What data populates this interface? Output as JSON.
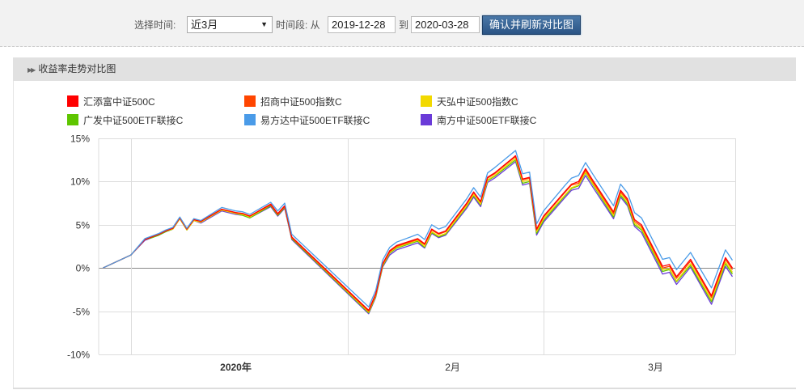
{
  "toolbar": {
    "select_time_label": "选择时间:",
    "period_value": "近3月",
    "range_label": "时间段: 从",
    "start_date": "2019-12-28",
    "to_label": "到",
    "end_date": "2020-03-28",
    "confirm_button": "确认并刷新对比图"
  },
  "panel": {
    "title": "收益率走势对比图"
  },
  "chart_data": {
    "type": "line",
    "title": "收益率走势对比图",
    "xlabel": "",
    "ylabel": "",
    "x_unit": "calendar days since 2019-12-28",
    "ylim": [
      -10,
      15
    ],
    "xlim": [
      -0.6,
      90.4
    ],
    "yticks": [
      {
        "v": 15,
        "label": "15%"
      },
      {
        "v": 10,
        "label": "10%"
      },
      {
        "v": 5,
        "label": "5%"
      },
      {
        "v": 0,
        "label": "0%"
      },
      {
        "v": -5,
        "label": "-5%"
      },
      {
        "v": -10,
        "label": "-10%"
      }
    ],
    "x_gridlines": [
      4,
      35,
      63
    ],
    "xticks": [
      {
        "d": 19,
        "label": "2020年",
        "bold": true
      },
      {
        "d": 50,
        "label": "2月",
        "bold": false
      },
      {
        "d": 79,
        "label": "3月",
        "bold": false
      }
    ],
    "legend_position": "top",
    "x": [
      0,
      4,
      6,
      7,
      8,
      9,
      10,
      11,
      12,
      13,
      14,
      17,
      19,
      20,
      21,
      24,
      25,
      26,
      27,
      38,
      39,
      40,
      41,
      42,
      45,
      46,
      47,
      48,
      49,
      52,
      53,
      54,
      55,
      56,
      59,
      60,
      61,
      62,
      63,
      66,
      67,
      68,
      69,
      70,
      73,
      74,
      75,
      76,
      77,
      80,
      81,
      82,
      84,
      87,
      89,
      90
    ],
    "series": [
      {
        "name": "汇添富中证500C",
        "color": "#ff0000",
        "values": [
          0,
          1.5,
          3.3,
          3.6,
          3.9,
          4.3,
          4.6,
          5.8,
          4.5,
          5.6,
          5.4,
          6.8,
          6.4,
          6.3,
          6.0,
          7.4,
          6.3,
          7.2,
          3.6,
          -4.9,
          -3.0,
          0.5,
          2.0,
          2.6,
          3.4,
          2.8,
          4.5,
          4.0,
          4.3,
          7.5,
          8.8,
          7.7,
          10.5,
          11.0,
          13.0,
          10.3,
          10.5,
          4.5,
          6.0,
          8.8,
          9.7,
          10.0,
          11.5,
          10.2,
          6.5,
          9.0,
          8.0,
          5.6,
          5.0,
          0.2,
          0.4,
          -1.0,
          1.0,
          -3.2,
          1.2,
          0.0
        ]
      },
      {
        "name": "招商中证500指数C",
        "color": "#ff4500",
        "values": [
          0,
          1.5,
          3.3,
          3.6,
          3.9,
          4.3,
          4.6,
          5.8,
          4.5,
          5.6,
          5.4,
          6.8,
          6.4,
          6.3,
          6.0,
          7.3,
          6.2,
          7.1,
          3.5,
          -5.0,
          -3.1,
          0.4,
          1.9,
          2.5,
          3.3,
          2.7,
          4.4,
          3.9,
          4.2,
          7.4,
          8.7,
          7.6,
          10.4,
          10.9,
          12.9,
          10.2,
          10.4,
          4.4,
          5.9,
          8.7,
          9.6,
          9.8,
          11.3,
          10.0,
          6.3,
          8.8,
          7.8,
          5.4,
          4.8,
          0.0,
          0.2,
          -1.2,
          0.8,
          -3.4,
          1.0,
          -0.2
        ]
      },
      {
        "name": "天弘中证500指数C",
        "color": "#f2d900",
        "values": [
          0,
          1.5,
          3.3,
          3.6,
          3.9,
          4.3,
          4.5,
          5.7,
          4.4,
          5.5,
          5.3,
          6.7,
          6.3,
          6.2,
          5.9,
          7.3,
          6.2,
          7.1,
          3.5,
          -5.1,
          -3.2,
          0.3,
          1.8,
          2.4,
          3.2,
          2.5,
          4.2,
          3.7,
          4.0,
          7.2,
          8.5,
          7.4,
          10.2,
          10.7,
          12.7,
          10.0,
          10.2,
          4.2,
          5.7,
          8.4,
          9.3,
          9.6,
          11.1,
          9.8,
          6.1,
          8.6,
          7.6,
          5.2,
          4.6,
          -0.2,
          -0.1,
          -1.5,
          0.5,
          -3.7,
          0.7,
          -0.5
        ]
      },
      {
        "name": "广发中证500ETF联接C",
        "color": "#5ec500",
        "values": [
          0,
          1.5,
          3.3,
          3.5,
          3.8,
          4.2,
          4.5,
          5.7,
          4.4,
          5.5,
          5.3,
          6.7,
          6.3,
          6.1,
          5.8,
          7.2,
          6.1,
          7.0,
          3.4,
          -5.2,
          -3.3,
          0.2,
          1.7,
          2.3,
          3.1,
          2.4,
          4.1,
          3.6,
          3.9,
          7.1,
          8.4,
          7.3,
          10.1,
          10.6,
          12.5,
          9.8,
          10.0,
          4.0,
          5.5,
          8.3,
          9.2,
          9.5,
          11.0,
          9.7,
          5.9,
          8.4,
          7.4,
          5.0,
          4.4,
          -0.4,
          -0.2,
          -1.6,
          0.3,
          -3.9,
          0.5,
          -0.7
        ]
      },
      {
        "name": "易方达中证500ETF联接C",
        "color": "#4a9be8",
        "values": [
          0,
          1.5,
          3.4,
          3.7,
          4.0,
          4.4,
          4.7,
          5.9,
          4.6,
          5.7,
          5.5,
          7.0,
          6.6,
          6.5,
          6.2,
          7.6,
          6.6,
          7.5,
          3.9,
          -4.5,
          -2.6,
          0.9,
          2.4,
          3.0,
          3.9,
          3.3,
          5.0,
          4.5,
          4.8,
          8.0,
          9.3,
          8.2,
          11.0,
          11.6,
          13.6,
          10.9,
          11.1,
          5.1,
          6.6,
          9.5,
          10.4,
          10.7,
          12.2,
          10.9,
          7.2,
          9.7,
          8.7,
          6.4,
          5.8,
          1.0,
          1.2,
          -0.2,
          1.8,
          -2.3,
          2.1,
          0.9
        ]
      },
      {
        "name": "南方中证500ETF联接C",
        "color": "#6a3bd8",
        "values": [
          0,
          1.5,
          3.2,
          3.5,
          3.8,
          4.2,
          4.5,
          5.7,
          4.4,
          5.5,
          5.2,
          6.6,
          6.2,
          6.1,
          5.8,
          7.1,
          6.0,
          6.9,
          3.3,
          -5.3,
          -3.4,
          0.1,
          1.5,
          2.1,
          2.9,
          2.3,
          4.0,
          3.5,
          3.8,
          6.9,
          8.2,
          7.1,
          9.9,
          10.4,
          12.3,
          9.6,
          9.8,
          3.8,
          5.3,
          8.1,
          9.0,
          9.2,
          10.7,
          9.4,
          5.7,
          8.2,
          7.2,
          4.8,
          4.1,
          -0.7,
          -0.5,
          -1.9,
          0.1,
          -4.2,
          0.2,
          -1.0
        ]
      }
    ]
  }
}
